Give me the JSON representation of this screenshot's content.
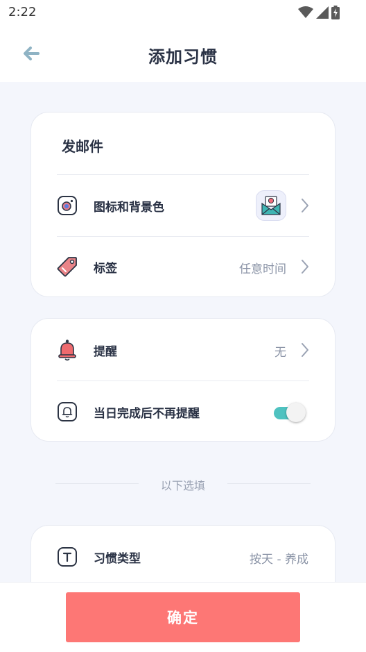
{
  "status_bar": {
    "time": "2:22",
    "icons": [
      "wifi-icon",
      "signal-icon",
      "battery-charging-icon"
    ]
  },
  "header": {
    "title": "添加习惯",
    "back_icon": "arrow-left-icon"
  },
  "habit": {
    "name": "发邮件",
    "rows": {
      "icon_bg": {
        "label": "图标和背景色",
        "icon": "camera-lens-icon",
        "preview_icon": "envelope-mail-icon"
      },
      "tag": {
        "label": "标签",
        "value": "任意时间",
        "icon": "tag-icon"
      }
    }
  },
  "reminder": {
    "row": {
      "label": "提醒",
      "value": "无",
      "icon": "bell-icon"
    },
    "no_remind_after_done": {
      "label": "当日完成后不再提醒",
      "icon": "bell-outline-icon",
      "enabled": true
    }
  },
  "optional": {
    "separator_text": "以下选填",
    "habit_type": {
      "label": "习惯类型",
      "value": "按天 - 养成",
      "icon": "text-type-icon"
    }
  },
  "footer": {
    "confirm_label": "确定"
  },
  "colors": {
    "accent_button": "#fd7775",
    "toggle_on": "#4fc2c0",
    "back_arrow": "#8fb3c4",
    "background": "#f4f6fc"
  }
}
